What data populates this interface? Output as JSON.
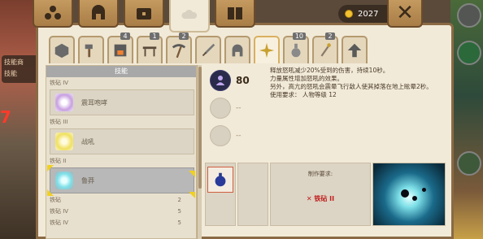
{
  "background": {
    "left_sign_lines": [
      "技能商",
      "技能"
    ],
    "left_mark": "7"
  },
  "topbar": {
    "tabs": [
      {
        "name": "guild-tab",
        "icon": "people-icon"
      },
      {
        "name": "armor-tab",
        "icon": "helmet-icon"
      },
      {
        "name": "chest-tab",
        "icon": "chest-icon"
      },
      {
        "name": "world-tab",
        "icon": "cloud-icon",
        "active": true
      },
      {
        "name": "map-tab",
        "icon": "book-icon"
      }
    ],
    "coins": "2027",
    "close_label": "✕"
  },
  "categories": [
    {
      "icon": "cube-icon",
      "badge": ""
    },
    {
      "icon": "hammer-icon",
      "badge": ""
    },
    {
      "icon": "furnace-icon",
      "badge": "4"
    },
    {
      "icon": "table-icon",
      "badge": "1"
    },
    {
      "icon": "pickaxe-icon",
      "badge": "2"
    },
    {
      "icon": "sword-icon",
      "badge": ""
    },
    {
      "icon": "helmet-icon",
      "badge": ""
    },
    {
      "icon": "sparkle-icon",
      "badge": "",
      "active": true
    },
    {
      "icon": "potion-icon",
      "badge": "10"
    },
    {
      "icon": "wand-icon",
      "badge": "2"
    },
    {
      "icon": "up-arrow-icon",
      "badge": ""
    }
  ],
  "list": {
    "header": "技能",
    "groups": [
      {
        "label": "铁砧 IV",
        "count": "",
        "item": {
          "name": "震耳咆哮",
          "selected": false
        }
      },
      {
        "label": "铁砧 III",
        "count": "",
        "item": {
          "name": "战吼",
          "selected": false
        }
      },
      {
        "label": "铁砧 II",
        "count": "",
        "item": {
          "name": "鲁莽",
          "selected": true
        }
      }
    ],
    "footer_groups": [
      {
        "label": "铁砧",
        "count": "2"
      },
      {
        "label": "铁砧 IV",
        "count": "5"
      },
      {
        "label": "铁砧 IV",
        "count": "5"
      }
    ]
  },
  "detail": {
    "bonus_value": "80",
    "bonus_placeholder": "--",
    "description": [
      "释放怒吼减少20%受到的伤害，持续10秒。",
      "力量属性增加怒吼的效果。",
      "另外，高亢的怒吼会震晕飞行敌人使其掉落在地上眩晕2秒。",
      "使用要求：  人物等级 12"
    ],
    "requirement_title": "制作要求:",
    "requirement_item": "✕ 铁砧 II"
  },
  "colors": {
    "panel": "#f2ead8",
    "border": "#8a6a44",
    "accent": "#f0d020",
    "requirement_red": "#c02020"
  }
}
